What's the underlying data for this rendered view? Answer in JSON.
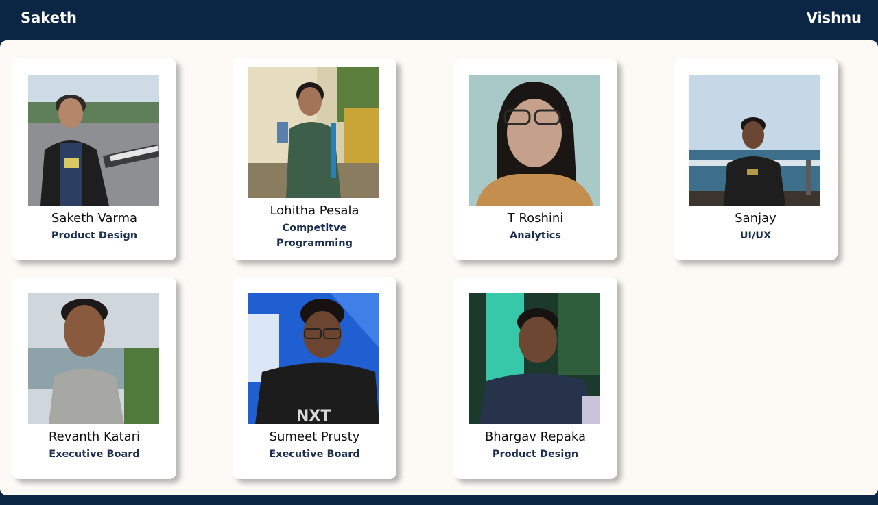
{
  "header": {
    "left_name": "Saketh",
    "right_name": "Vishnu"
  },
  "members": [
    {
      "name": "Saketh Varma",
      "domain": "Product Design"
    },
    {
      "name": "Lohitha Pesala",
      "domain": "Competitve Programming"
    },
    {
      "name": "T Roshini",
      "domain": "Analytics"
    },
    {
      "name": "Sanjay",
      "domain": "UI/UX"
    },
    {
      "name": "Revanth Katari",
      "domain": "Executive Board"
    },
    {
      "name": "Sumeet Prusty",
      "domain": "Executive Board"
    },
    {
      "name": "Bhargav Repaka",
      "domain": "Product Design"
    }
  ],
  "colors": {
    "navy": "#0b2545",
    "page_background": "#fdfaf5",
    "card": "#ffffff",
    "domain_text": "#1a2e4f"
  }
}
